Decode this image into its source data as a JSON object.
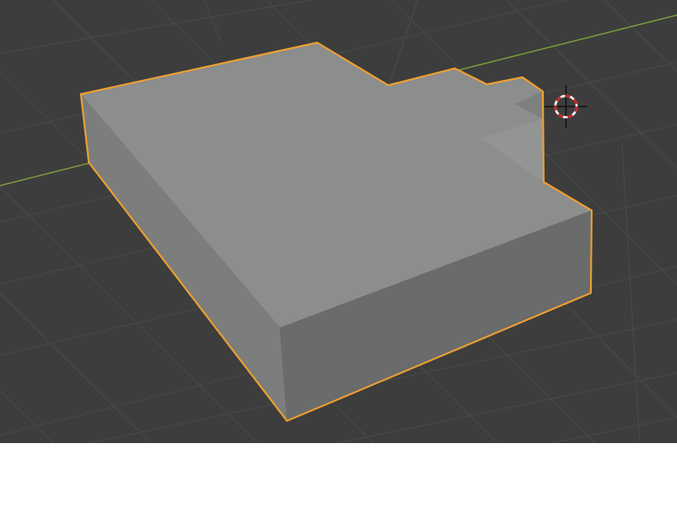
{
  "viewport": {
    "background_color": "#3d3d3d",
    "grid_color": "#4a4a4a",
    "x_axis_color": "#7a9a3a",
    "selection_outline_color": "#f0a030",
    "cursor_color_primary": "#d02020",
    "cursor_color_secondary": "#ffffff",
    "object": {
      "name": "",
      "selected": true,
      "top_face_color": "#8c8d8d",
      "left_face_color": "#7c7d7d",
      "front_face_color": "#6a6b6b",
      "inner_face_color": "#909191"
    },
    "icons": {
      "cursor": "3d-cursor-icon"
    }
  },
  "below_area": {
    "background_color": "#ffffff"
  }
}
